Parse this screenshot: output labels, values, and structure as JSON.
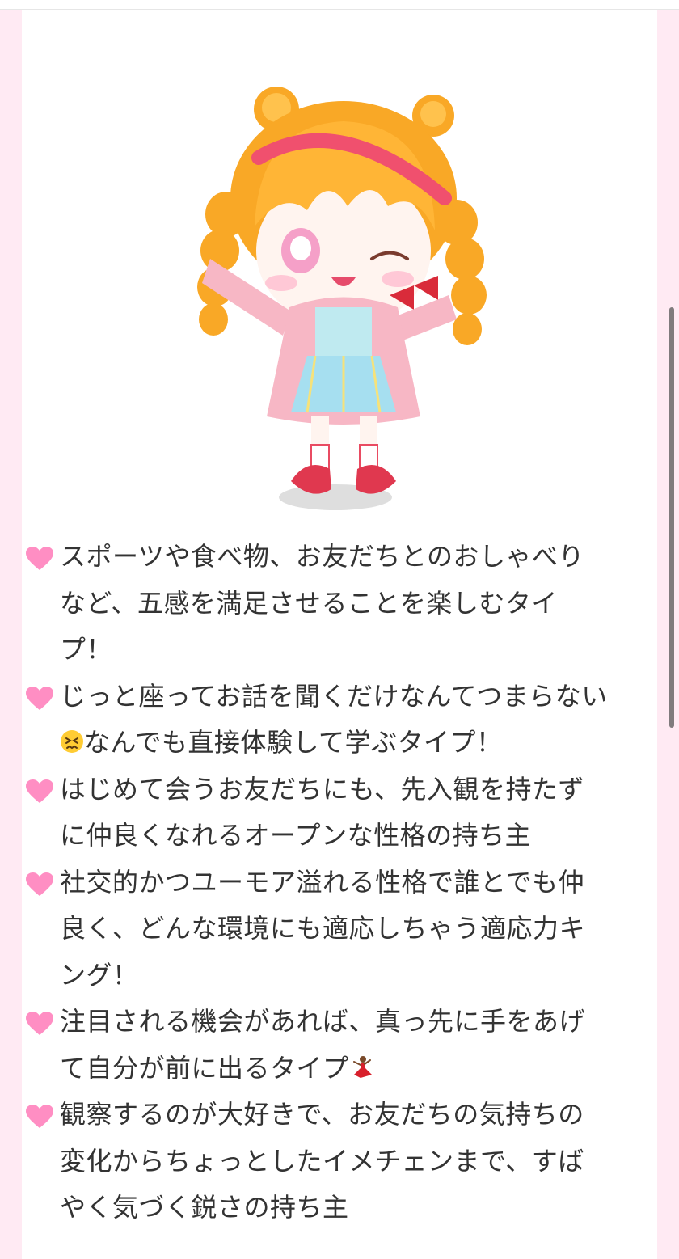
{
  "colors": {
    "page_background": "#ffeaf3",
    "panel_background": "#ffffff",
    "heart": "#ff8ec3",
    "text": "#333333"
  },
  "avatar": {
    "description_icon": "avatar-image"
  },
  "traits": [
    {
      "text": "スポーツや食べ物、お友だちとのおしゃべりなど、五感を満足させることを楽しむタイプ！"
    },
    {
      "text_before": "じっと座ってお話を聞くだけなんてつまらない",
      "emoji": "confounded-face-emoji",
      "text_after": "なんでも直接体験して学ぶタイプ！"
    },
    {
      "text": "はじめて会うお友だちにも、先入観を持たずに仲良くなれるオープンな性格の持ち主"
    },
    {
      "text": "社交的かつユーモア溢れる性格で誰とでも仲良く、どんな環境にも適応しちゃう適応力キング！"
    },
    {
      "text_before": "注目される機会があれば、真っ先に手をあげて自分が前に出るタイプ",
      "emoji": "dancer-emoji",
      "text_after": ""
    },
    {
      "text": "観察するのが大好きで、お友だちの気持ちの変化からちょっとしたイメチェンまで、すばやく気づく鋭さの持ち主"
    }
  ]
}
